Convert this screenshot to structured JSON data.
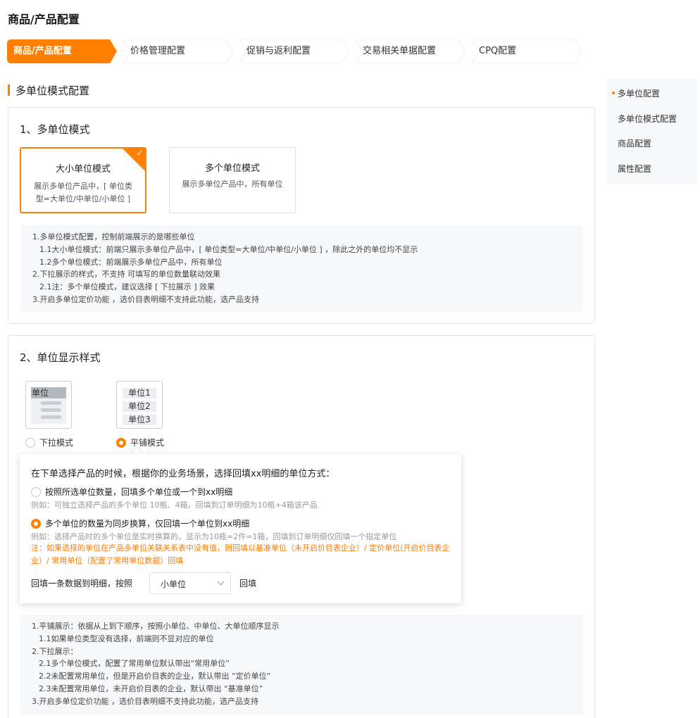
{
  "page": {
    "title": "商品/产品配置"
  },
  "steps": [
    {
      "label": "商品/产品配置",
      "active": true
    },
    {
      "label": "价格管理配置",
      "active": false
    },
    {
      "label": "促销与返利配置",
      "active": false
    },
    {
      "label": "交易相关单据配置",
      "active": false
    },
    {
      "label": "CPQ配置",
      "active": false
    }
  ],
  "section": {
    "title": "多单位模式配置"
  },
  "anchor_nav": {
    "items": [
      {
        "label": "多单位配置",
        "active": true
      },
      {
        "label": "多单位模式配置",
        "active": false
      },
      {
        "label": "商品配置",
        "active": false
      },
      {
        "label": "属性配置",
        "active": false
      }
    ]
  },
  "card1": {
    "title": "1、多单位模式",
    "modes": [
      {
        "title": "大小单位模式",
        "desc1": "展示多单位产品中，[ 单位类",
        "desc2": "型=大单位/中单位/小单位 ]",
        "selected": true
      },
      {
        "title": "多个单位模式",
        "desc1": "展示多单位产品中，所有单位",
        "desc2": "",
        "selected": false
      }
    ],
    "notes": [
      {
        "text": "1.多单位模式配置，控制前端展示的是哪些单位",
        "level": 1
      },
      {
        "text": "1.1大小单位模式：前端只展示多单位产品中，[ 单位类型=大单位/中单位/小单位 ] ，除此之外的单位均不显示",
        "level": 2
      },
      {
        "text": "1.2多个单位模式：前端展示多单位产品中，所有单位",
        "level": 2
      },
      {
        "text": "2.下拉展示的样式，不支持 可填写的单位数量联动效果",
        "level": 1
      },
      {
        "text": "2.1注：多个单位模式，建议选择 [ 下拉展示 ] 效果",
        "level": 2
      },
      {
        "text": "3.开启多单位定价功能 ，选价目表明细不支持此功能，选产品支持",
        "level": 1
      }
    ]
  },
  "card2": {
    "title": "2、单位显示样式",
    "dropdown_thumb": {
      "label": "单位"
    },
    "tile_thumb": {
      "items": [
        "单位1",
        "单位2",
        "单位3"
      ]
    },
    "styles": [
      {
        "label": "下拉模式",
        "selected": false
      },
      {
        "label": "平铺模式",
        "selected": true
      }
    ],
    "popover": {
      "question": "在下单选择产品的时候，根据你的业务场景，选择回填xx明细的单位方式：",
      "option1": {
        "label": "按照所选单位数量，回填多个单位或一个到xx明细",
        "example": "例如：可独立选择产品的多个单位 10瓶、4箱，回填到订单明细为10瓶+4箱该产品",
        "selected": false
      },
      "option2": {
        "label": "多个单位的数量为同步换算，仅回填一个单位到xx明细",
        "example": "例如：选择产品时的多个单位是实时换算的，显示为10瓶=2件=1箱，回填到订单明细仅回填一个指定单位",
        "selected": true
      },
      "warning": "注：如果选择的单位在产品多单位关联关系表中没有值，则回填以基准单位（未开启价目表企业）/ 定价单位(开启价目表企业）/ 常用单位（配置了常用单位数据）回填",
      "fill_label": "回填一条数据到明细，按照",
      "fill_value": "小单位",
      "fill_after": "回填"
    },
    "notes": [
      {
        "text": "1.平铺展示：依据从上到下顺序，按照小单位、中单位、大单位顺序显示",
        "level": 1
      },
      {
        "text": "1.1如果单位类型没有选择，前端则不显对应的单位",
        "level": 2
      },
      {
        "text": "2.下拉展示：",
        "level": 1
      },
      {
        "text": "2.1多个单位模式，配置了常用单位默认带出“常用单位”",
        "level": 2
      },
      {
        "text": "2.2未配置常用单位，但是开启价目表的企业，默认带出 “定价单位”",
        "level": 2
      },
      {
        "text": "2.3未配置常用单位，未开启价目表的企业，默认带出 “基准单位”",
        "level": 2
      },
      {
        "text": "3.开启多单位定价功能 ，选价目表明细不支持此功能，选产品支持",
        "level": 1
      }
    ]
  },
  "colors": {
    "accent": "#ff8000",
    "warning_text": "#ff7a00",
    "note_bg": "#f7f8fa"
  }
}
